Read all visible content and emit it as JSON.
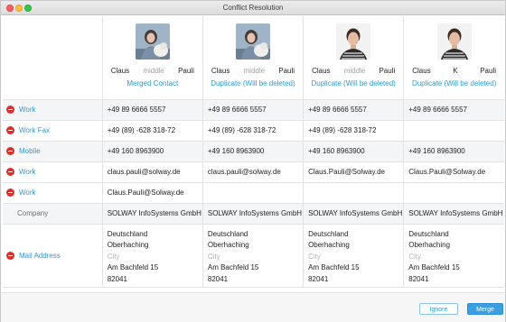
{
  "window": {
    "title": "Conflict Resolution"
  },
  "contacts": [
    {
      "first": "Claus",
      "middle": "middle",
      "last": "Pauli",
      "status": "Merged Contact",
      "photo": "woman-with-dog"
    },
    {
      "first": "Claus",
      "middle": "middle",
      "last": "Pauli",
      "status": "Duplicate (Will be deleted)",
      "photo": "woman-with-dog"
    },
    {
      "first": "Claus",
      "middle": "middle",
      "last": "Pauli",
      "status": "Duplicate (Will be deleted)",
      "photo": "man-portrait"
    },
    {
      "first": "Claus",
      "middle": "K",
      "last": "Pauli",
      "status": "Duplicate (Will be deleted)",
      "photo": "man-portrait"
    }
  ],
  "rows": [
    {
      "label": "Work",
      "removable": true,
      "values": [
        "+49 89 6666 5557",
        "+49 89 6666 5557",
        "+49 89 6666 5557",
        "+49 89 6666 5557"
      ]
    },
    {
      "label": "Work Fax",
      "removable": true,
      "values": [
        "+49 (89) -628 318-72",
        "+49 (89) -628 318-72",
        "+49 (89) -628 318-72",
        ""
      ]
    },
    {
      "label": "Mobile",
      "removable": true,
      "values": [
        "+49 160 8963900",
        "+49 160 8963900",
        "+49 160 8963900",
        "+49 160 8963900"
      ]
    },
    {
      "label": "Work",
      "removable": true,
      "values": [
        "claus.pauli@solway.de",
        "claus.pauli@solway.de",
        "Claus.Pauli@Solway.de",
        "Claus.Pauli@Solway.de"
      ]
    },
    {
      "label": "Work",
      "removable": true,
      "values": [
        "Claus.Pauli@Solway.de",
        "",
        "",
        ""
      ]
    },
    {
      "label": "Company",
      "removable": false,
      "values": [
        "SOLWAY InfoSystems GmbH",
        "SOLWAY InfoSystems GmbH",
        "SOLWAY InfoSystems GmbH",
        "SOLWAY InfoSystems GmbH"
      ]
    }
  ],
  "mail": {
    "label": "Mail Address",
    "addresses": [
      {
        "country": "Deutschland",
        "region": "Oberhaching",
        "city": "City",
        "street": "Am Bachfeld 15",
        "zip": "82041"
      },
      {
        "country": "Deutschland",
        "region": "Oberhaching",
        "city": "City",
        "street": "Am Bachfeld 15",
        "zip": "82041"
      },
      {
        "country": "Deutschland",
        "region": "Oberhaching",
        "city": "City",
        "street": "Am Bachfeld 15",
        "zip": "82041"
      },
      {
        "country": "Deutschland",
        "region": "Oberhaching",
        "city": "City",
        "street": "Am Bachfeld 15",
        "zip": "82041"
      }
    ]
  },
  "footer": {
    "ignore_label": "Ignore",
    "merge_label": "Merge"
  },
  "colors": {
    "accent": "#2e9bd6",
    "remove": "#d9302c",
    "merge_button": "#3a9ee0"
  }
}
